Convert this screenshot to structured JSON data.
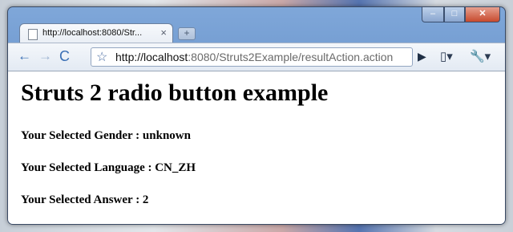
{
  "tab": {
    "title": "http://localhost:8080/Str...",
    "close": "×"
  },
  "newtab": "+",
  "window_controls": {
    "minimize": "–",
    "maximize": "□",
    "close": "✕"
  },
  "toolbar": {
    "back": "←",
    "forward": "→",
    "reload": "C",
    "star": "☆",
    "url_host": "http://localhost",
    "url_path": ":8080/Struts2Example/resultAction.action",
    "go": "▶",
    "page_menu": "▯▾",
    "wrench_menu": "🔧▾"
  },
  "page": {
    "heading": "Struts 2 radio button example",
    "gender_line": "Your Selected Gender : unknown",
    "language_line": "Your Selected Language : CN_ZH",
    "answer_line": "Your Selected Answer : 2"
  }
}
